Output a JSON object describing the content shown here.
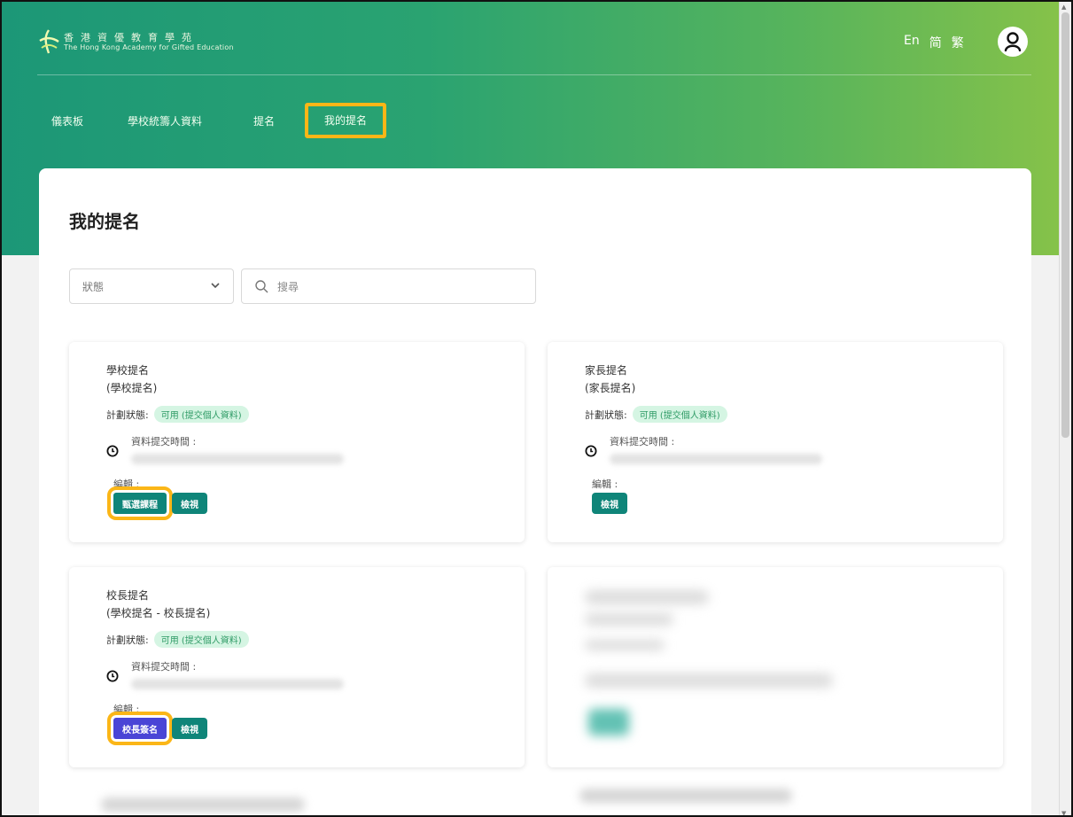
{
  "colors": {
    "accent_teal": "#0f8579",
    "accent_purple": "#4a45d6",
    "highlight": "#fbb617",
    "badge_bg": "#d5f5e3",
    "badge_text": "#2f9b66"
  },
  "header": {
    "logo_zh": "香港資優教育學苑",
    "logo_en": "The Hong Kong Academy for Gifted Education",
    "languages": [
      "En",
      "简",
      "繁"
    ],
    "user_icon": "user-icon"
  },
  "nav": {
    "items": [
      {
        "label": "儀表板"
      },
      {
        "label": "學校統籌人資料"
      },
      {
        "label": "提名"
      },
      {
        "label": "我的提名"
      }
    ],
    "active_index": 3
  },
  "page": {
    "title": "我的提名",
    "status_filter": {
      "placeholder": "狀態"
    },
    "search": {
      "placeholder": "搜尋",
      "value": ""
    }
  },
  "cards": [
    {
      "title": "學校提名",
      "subtitle": "(學校提名)",
      "plan_label": "計劃狀態:",
      "plan_status": "可用 (提交個人資料)",
      "submit_label": "資料提交時間 :",
      "edit_label": "編輯 :",
      "buttons": [
        "甄選課程",
        "檢視"
      ]
    },
    {
      "title": "家長提名",
      "subtitle": "(家長提名)",
      "plan_label": "計劃狀態:",
      "plan_status": "可用 (提交個人資料)",
      "submit_label": "資料提交時間 :",
      "edit_label": "編輯 :",
      "buttons": [
        "檢視"
      ]
    },
    {
      "title": "校長提名",
      "subtitle": "(學校提名 - 校長提名)",
      "plan_label": "計劃狀態:",
      "plan_status": "可用 (提交個人資料)",
      "submit_label": "資料提交時間 :",
      "edit_label": "編輯 :",
      "buttons": [
        "校長簽名",
        "檢視"
      ]
    }
  ]
}
